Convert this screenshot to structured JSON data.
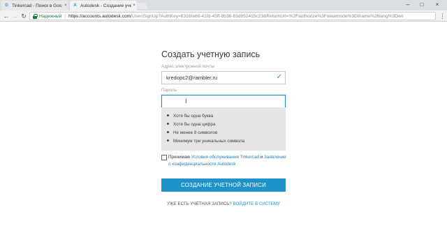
{
  "browser": {
    "tabs": [
      {
        "label": "Tinkercad - Поиск в Goo",
        "favicon": "G",
        "favicon_color": "#4285f4"
      },
      {
        "label": "Autodesk - Создание уче",
        "favicon": "A",
        "favicon_color": "#0696d7"
      }
    ],
    "close_glyph": "×",
    "window_controls": {
      "minimize": "–",
      "maximize": "□",
      "close": "×"
    },
    "nav": {
      "back": "←",
      "forward": "→",
      "reload": "↻",
      "menu": "⋮"
    },
    "omnibox": {
      "secure_label": "Надежный",
      "separator": "|",
      "host": "https://accounts.autodesk.com",
      "path": "/User/SignUp?AuthKey=6316fa66-41fd-45ff-8b36-83d852415c23&ReturnUrl=%2Fauthorize%3Fviewmode%3Diframe%26lang%3Den"
    }
  },
  "form": {
    "title": "Создать учетную запись",
    "email_label": "Адрес электронной почты",
    "email_value": "kredopc2@rambler.ru",
    "email_check": "✓",
    "password_label": "Пароль",
    "password_caret": "I",
    "password_rules": [
      "Хотя бы одна буква",
      "Хотя бы одна цифра",
      "Не менее 8 символов",
      "Минимум три уникальных символа"
    ],
    "terms_prefix": "Принимаю ",
    "terms_link1": "Условия обслуживания Tinkercad",
    "terms_and": " и ",
    "terms_link2": "Заявление о конфиденциальности Autodesk",
    "submit_label": "СОЗДАНИЕ УЧЕТНОЙ ЗАПИСИ",
    "have_account": "УЖЕ ЕСТЬ УЧЕТНАЯ ЗАПИСЬ?",
    "sign_in_link": "ВОЙДИТЕ В СИСТЕМУ"
  },
  "colors": {
    "accent": "#1f92c9",
    "secure_green": "#0b8043",
    "rules_bg": "#e5e5e5"
  }
}
